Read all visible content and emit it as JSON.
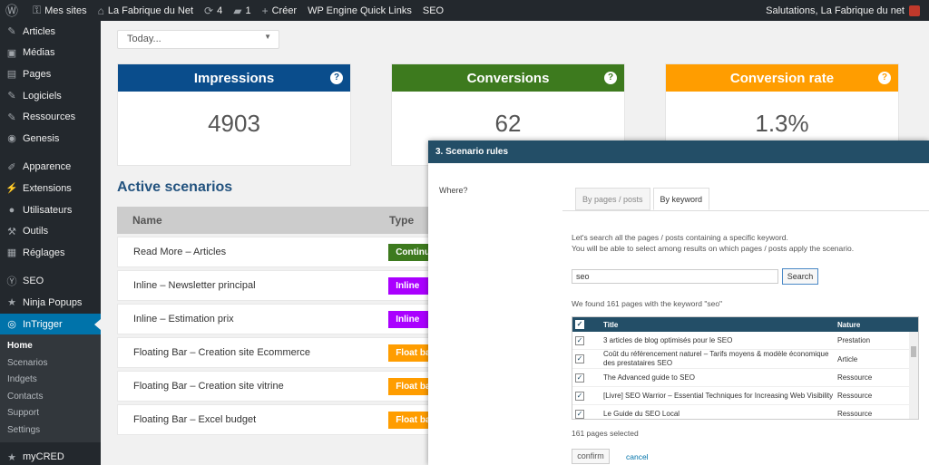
{
  "adminbar": {
    "my_sites": "Mes sites",
    "site_name": "La Fabrique du Net",
    "updates": "4",
    "comments": "1",
    "new": "Créer",
    "wpengine": "WP Engine Quick Links",
    "seo": "SEO",
    "greeting": "Salutations, La Fabrique du net"
  },
  "sidebar": {
    "items": [
      {
        "label": "Articles",
        "icon": "pin-icon"
      },
      {
        "label": "Médias",
        "icon": "media-icon"
      },
      {
        "label": "Pages",
        "icon": "pages-icon"
      },
      {
        "label": "Logiciels",
        "icon": "pin-icon"
      },
      {
        "label": "Ressources",
        "icon": "pin-icon"
      },
      {
        "label": "Genesis",
        "icon": "genesis-icon"
      },
      {
        "label": "Apparence",
        "icon": "brush-icon"
      },
      {
        "label": "Extensions",
        "icon": "plugin-icon"
      },
      {
        "label": "Utilisateurs",
        "icon": "users-icon"
      },
      {
        "label": "Outils",
        "icon": "wrench-icon"
      },
      {
        "label": "Réglages",
        "icon": "settings-icon"
      },
      {
        "label": "SEO",
        "icon": "yoast-icon"
      },
      {
        "label": "Ninja Popups",
        "icon": "star-icon"
      },
      {
        "label": "InTrigger",
        "icon": "intrigger-icon"
      }
    ],
    "submenu": [
      "Home",
      "Scenarios",
      "Indgets",
      "Contacts",
      "Support",
      "Settings"
    ],
    "mycred": "myCRED"
  },
  "main": {
    "date_select": "Today...",
    "cards": [
      {
        "title": "Impressions",
        "value": "4903",
        "color": "#0a4d8c"
      },
      {
        "title": "Conversions",
        "value": "62",
        "color": "#3d7a1e"
      },
      {
        "title": "Conversion rate",
        "value": "1.3%",
        "color": "#ff9d00"
      }
    ],
    "scenarios_title": "Active scenarios",
    "table_headers": {
      "name": "Name",
      "type": "Type"
    },
    "scenarios": [
      {
        "name": "Read More – Articles",
        "type": "Continue",
        "color": "#3d7a1e"
      },
      {
        "name": "Inline – Newsletter principal",
        "type": "Inline",
        "color": "#aa00ff"
      },
      {
        "name": "Inline – Estimation prix",
        "type": "Inline",
        "color": "#aa00ff"
      },
      {
        "name": "Floating Bar – Creation site Ecommerce",
        "type": "Float bar",
        "color": "#ff9d00"
      },
      {
        "name": "Floating Bar – Creation site vitrine",
        "type": "Float bar",
        "color": "#ff9d00"
      },
      {
        "name": "Floating Bar – Excel budget",
        "type": "Float bar",
        "color": "#ff9d00"
      }
    ]
  },
  "modal": {
    "title": "3. Scenario rules",
    "where": "Where?",
    "tabs": [
      "By pages / posts",
      "By keyword"
    ],
    "desc_line1": "Let's search all the pages / posts containing a specific keyword.",
    "desc_line2": "You will be able to select among results on which pages / posts apply the scenario.",
    "keyword": "seo",
    "search_label": "Search",
    "found": "We found 161 pages with the keyword \"seo\"",
    "col_title": "Title",
    "col_nature": "Nature",
    "results": [
      {
        "title": "3 articles de blog optimisés pour le SEO",
        "nature": "Prestation"
      },
      {
        "title": "Coût du référencement naturel – Tarifs moyens & modèle économique des prestataires SEO",
        "nature": "Article"
      },
      {
        "title": "The Advanced guide to SEO",
        "nature": "Ressource"
      },
      {
        "title": "[Livre] SEO Warrior – Essential Techniques for Increasing Web Visibility",
        "nature": "Ressource"
      },
      {
        "title": "Le Guide du SEO Local",
        "nature": "Ressource"
      }
    ],
    "selected_count": "161 pages selected",
    "confirm": "confirm",
    "cancel": "cancel"
  }
}
